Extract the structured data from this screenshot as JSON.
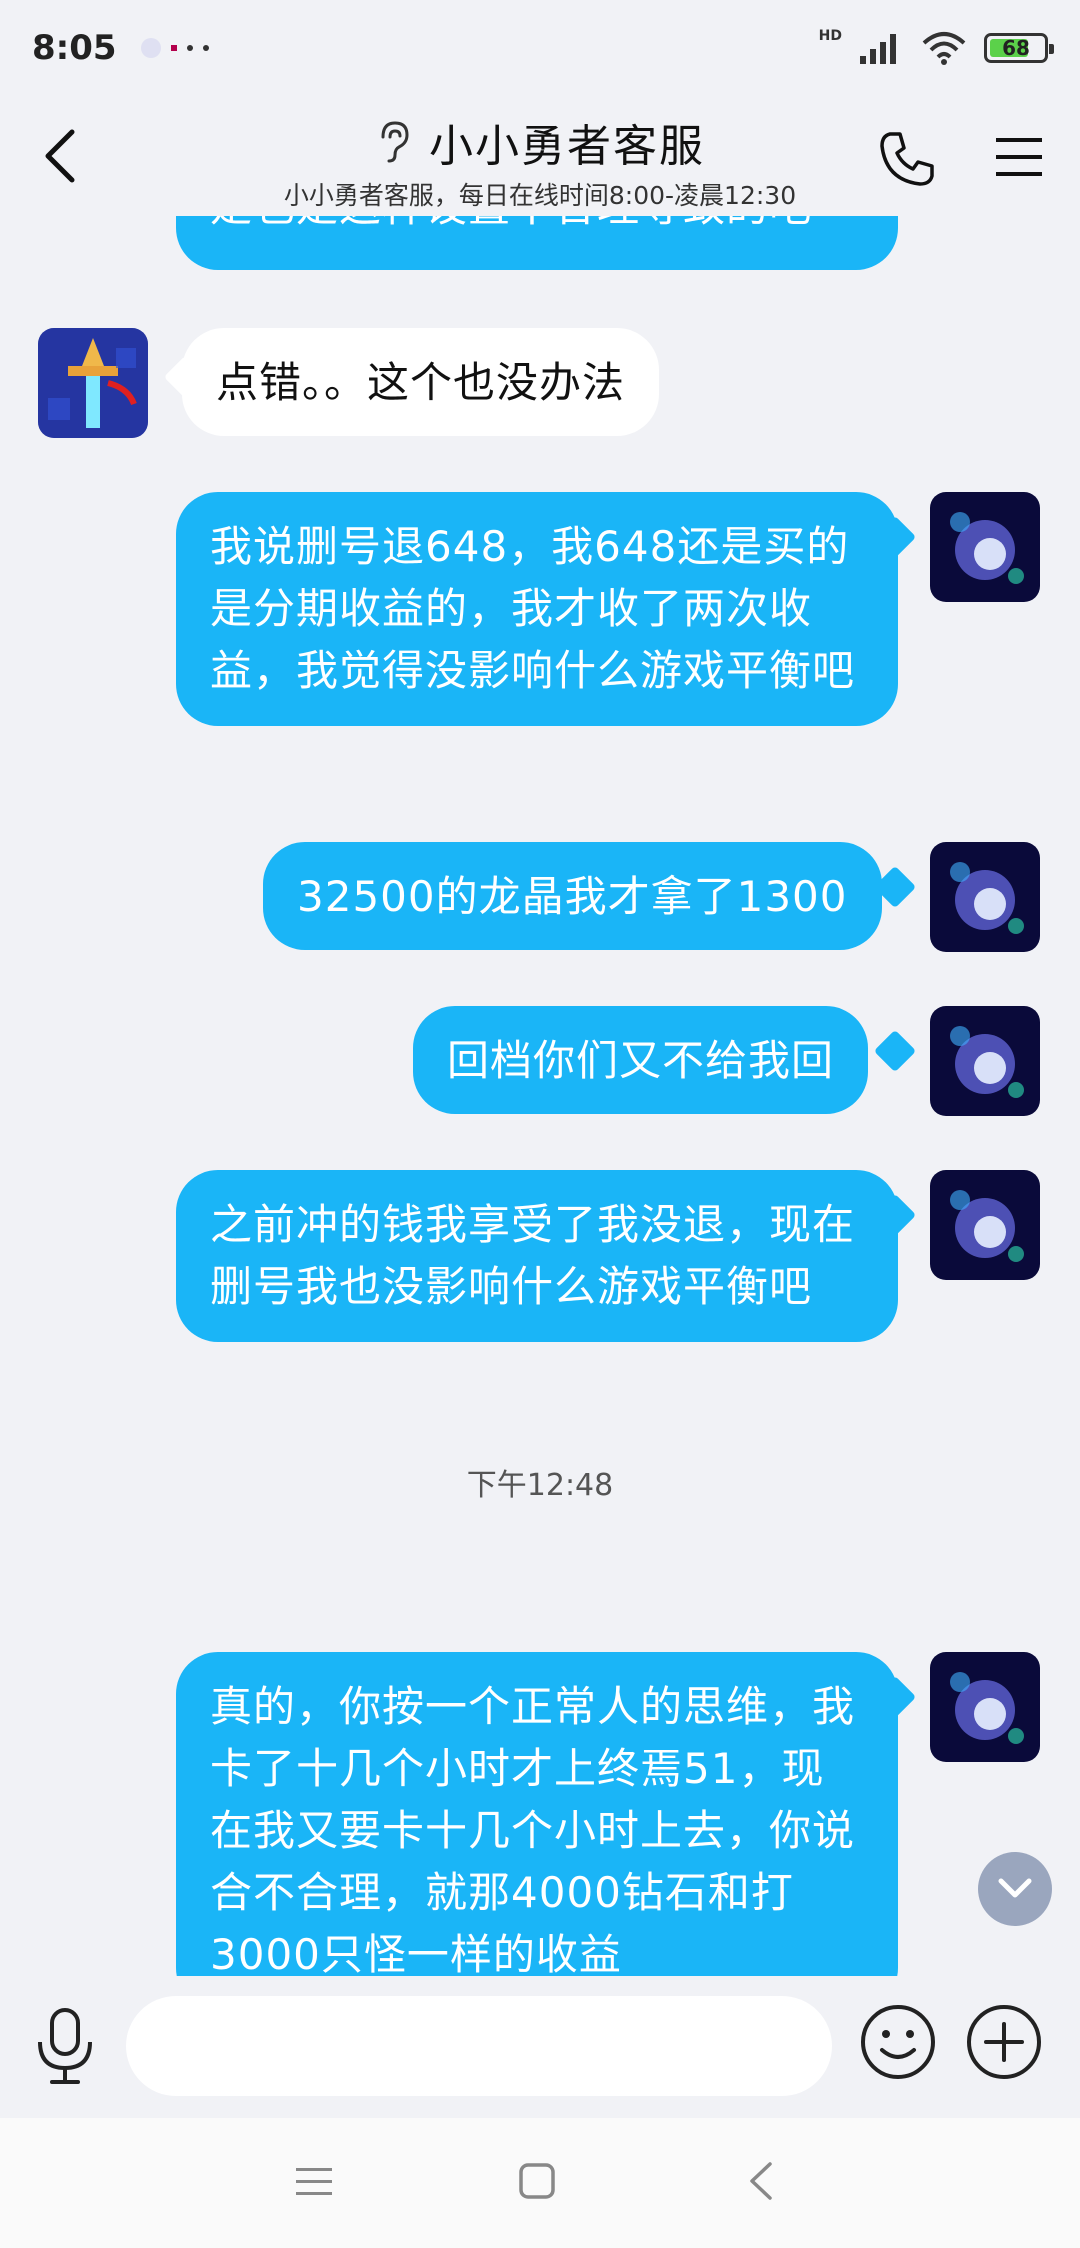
{
  "status_bar": {
    "time": "8:05",
    "hd_label": "HD",
    "battery_level": "68",
    "icons": [
      "signal-icon",
      "wifi-icon",
      "battery-icon"
    ]
  },
  "header": {
    "title": "小小勇者客服",
    "subtitle": "小小勇者客服，每日在线时间8:00-凌晨12:30",
    "icons": [
      "back-icon",
      "ear-icon",
      "phone-icon",
      "menu-icon"
    ]
  },
  "messages": {
    "partial_top": "是也是这种设置不合理导致的吧",
    "m1": "点错。。这个也没办法",
    "m2": "我说删号退648，我648还是买的是分期收益的，我才收了两次收益，我觉得没影响什么游戏平衡吧",
    "m3": "32500的龙晶我才拿了1300",
    "m4": "回档你们又不给我回",
    "m5": "之前冲的钱我享受了我没退，现在删号我也没影响什么游戏平衡吧",
    "timestamp": "下午12:48",
    "m6": "真的，你按一个正常人的思维，我卡了十几个小时才上终焉51，现在我又要卡十几个小时上去，你说合不合理，就那4000钻石和打3000只怪一样的收益"
  },
  "input": {
    "placeholder": "",
    "value": ""
  },
  "colors": {
    "outgoing_bubble": "#1ab5f7",
    "incoming_bubble": "#ffffff",
    "background": "#f1f2f6"
  }
}
